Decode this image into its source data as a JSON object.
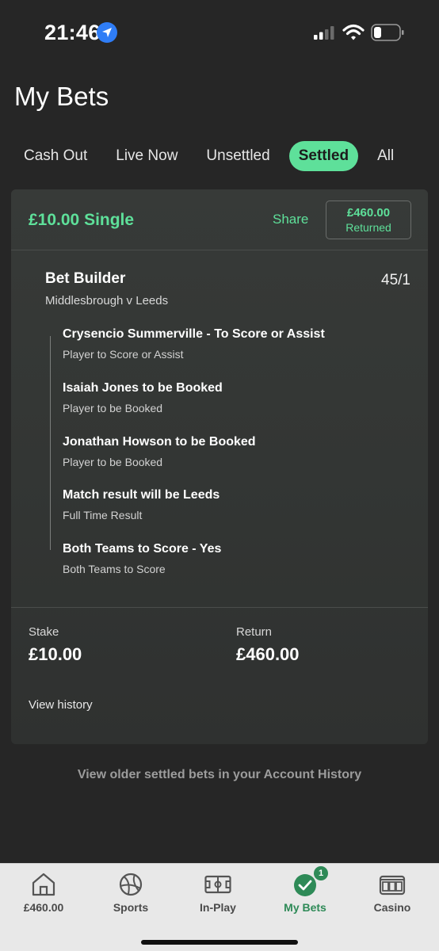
{
  "status_bar": {
    "time": "21:46"
  },
  "page": {
    "title": "My Bets"
  },
  "tabs": [
    {
      "label": "Cash Out",
      "active": false
    },
    {
      "label": "Live Now",
      "active": false
    },
    {
      "label": "Unsettled",
      "active": false
    },
    {
      "label": "Settled",
      "active": true
    },
    {
      "label": "All",
      "active": false
    }
  ],
  "bet": {
    "type_label": "£10.00 Single",
    "share_label": "Share",
    "returned_amount": "£460.00",
    "returned_label": "Returned",
    "builder_title": "Bet Builder",
    "odds": "45/1",
    "match": "Middlesbrough v Leeds",
    "legs": [
      {
        "title": "Crysencio Summerville - To Score or Assist",
        "market": "Player to Score or Assist"
      },
      {
        "title": "Isaiah Jones to be Booked",
        "market": "Player to be Booked"
      },
      {
        "title": "Jonathan Howson to be Booked",
        "market": "Player to be Booked"
      },
      {
        "title": "Match result will be Leeds",
        "market": "Full Time Result"
      },
      {
        "title": "Both Teams to Score - Yes",
        "market": "Both Teams to Score"
      }
    ],
    "stake_label": "Stake",
    "stake_value": "£10.00",
    "return_label": "Return",
    "return_value": "£460.00",
    "view_history": "View history"
  },
  "older_bets_link": "View older settled bets in your Account History",
  "bottom_nav": [
    {
      "label": "£460.00",
      "icon": "home-icon",
      "active": false
    },
    {
      "label": "Sports",
      "icon": "football-icon",
      "active": false
    },
    {
      "label": "In-Play",
      "icon": "pitch-icon",
      "active": false
    },
    {
      "label": "My Bets",
      "icon": "check-circle-icon",
      "active": true,
      "badge": "1"
    },
    {
      "label": "Casino",
      "icon": "slot-machine-icon",
      "active": false
    }
  ],
  "colors": {
    "accent": "#5ee09a",
    "active_nav": "#2e8a57",
    "background": "#262626",
    "card": "#353836"
  }
}
